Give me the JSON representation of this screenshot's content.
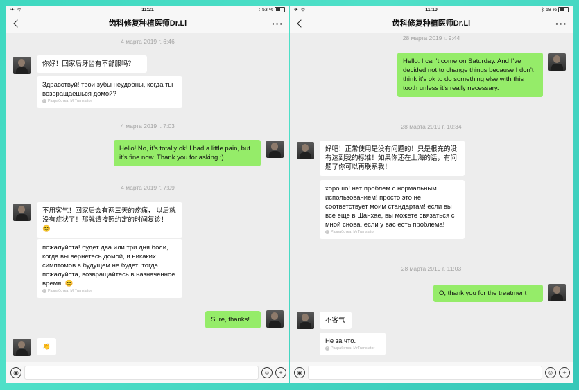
{
  "left": {
    "status": {
      "time": "11:21",
      "battery": "53 %",
      "battery_level": 0.53
    },
    "title": "齿科修复种植医师Dr.Li",
    "more": "···",
    "timestamps": [
      "4 марта 2019 г. 6:46",
      "4 марта 2019 г. 7:03",
      "4 марта 2019 г. 7:09"
    ],
    "messages": {
      "m1_original": "你好！回家后牙齿有不舒服吗？",
      "m1_translation": "Здравствуй! твои зубы неудобны, когда ты возвращаешься домой?",
      "m2": "Hello! No, it’s totally ok! I had a little pain, but it’s fine now. Thank you for asking :)",
      "m3_original": "不用客气！回家后会有两三天的疼痛，  以后就没有症状了！那就请按照约定的时间复诊！ 😊",
      "m3_translation": "пожалуйста! будет два или три дня боли, когда вы вернетесь домой, и никаких симптомов в будущем не будет! тогда, пожалуйста, возвращайтесь в назначенное время! 😊",
      "m4": "Sure, thanks!",
      "m5": "👏"
    },
    "credit": "Разработка: MrTranslator"
  },
  "right": {
    "status": {
      "time": "11:10",
      "battery": "58 %",
      "battery_level": 0.58
    },
    "title": "齿科修复种植医师Dr.Li",
    "more": "···",
    "timestamps": [
      "28 марта 2019 г. 9:44",
      "28 марта 2019 г. 10:34",
      "28 марта 2019 г. 11:03"
    ],
    "messages": {
      "m1": "Hello. I can’t come on Saturday. And I’ve decided not to change things because I don’t think it’s ok to do something else with this tooth unless it’s really necessary.",
      "m2_original": "好吧！正常使用是没有问题的！只是根充的没有达到我的标准！如果你还在上海的话，有问题了你可以再联系我！",
      "m2_translation": "хорошо! нет проблем с нормальным использованием! просто это не соответствует моим стандартам! если вы все еще в Шанхае, вы можете связаться с мной снова, если у вас есть проблема!",
      "m3": "O, thank you for the treatment",
      "m4_original": "不客气",
      "m4_translation": "Не за что."
    },
    "credit": "Разработка: MrTranslator"
  }
}
